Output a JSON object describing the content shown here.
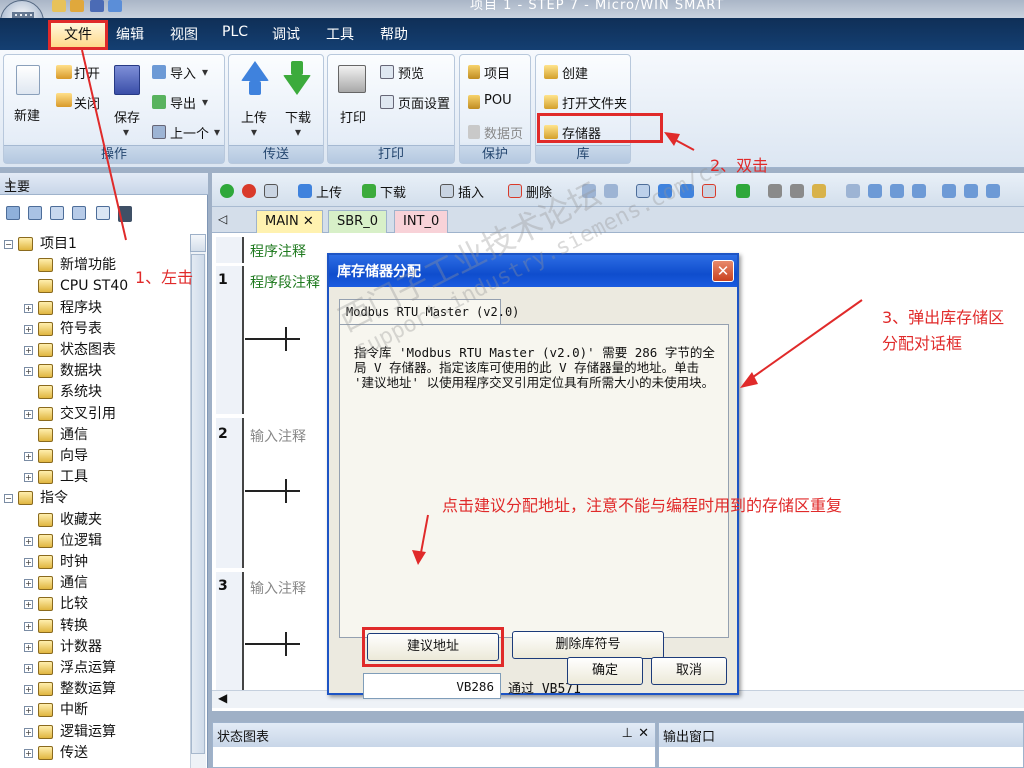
{
  "app": {
    "title": "项目 1 - STEP 7 - Micro/WIN SMART"
  },
  "menu": {
    "items": [
      "文件",
      "编辑",
      "视图",
      "PLC",
      "调试",
      "工具",
      "帮助"
    ]
  },
  "ribbon": {
    "groups": [
      {
        "label": "操作",
        "buttons": [
          "新建",
          "打开",
          "关闭",
          "保存",
          "导入",
          "导出",
          "上一个"
        ]
      },
      {
        "label": "传送",
        "buttons": [
          "上传",
          "下载"
        ]
      },
      {
        "label": "打印",
        "buttons": [
          "打印",
          "预览",
          "页面设置"
        ]
      },
      {
        "label": "保护",
        "buttons": [
          "项目",
          "POU",
          "数据页"
        ]
      },
      {
        "label": "库",
        "buttons": [
          "创建",
          "打开文件夹",
          "存储器"
        ]
      }
    ]
  },
  "left_pane": {
    "title": "主要",
    "tree": [
      "项目1",
      "新增功能",
      "CPU ST40",
      "程序块",
      "符号表",
      "状态图表",
      "数据块",
      "系统块",
      "交叉引用",
      "通信",
      "向导",
      "工具",
      "指令",
      "收藏夹",
      "位逻辑",
      "时钟",
      "通信",
      "比较",
      "转换",
      "计数器",
      "浮点运算",
      "整数运算",
      "中断",
      "逻辑运算",
      "传送"
    ]
  },
  "editor": {
    "toolbar": [
      "上传",
      "下载",
      "插入",
      "删除"
    ],
    "tabs": [
      "MAIN",
      "SBR_0",
      "INT_0"
    ],
    "program_comment": "程序注释",
    "networks": [
      {
        "num": "1",
        "comment": "程序段注释"
      },
      {
        "num": "2",
        "comment": "输入注释"
      },
      {
        "num": "3",
        "comment": "输入注释"
      }
    ]
  },
  "bottom": {
    "left_title": "状态图表",
    "right_title": "输出窗口"
  },
  "dialog": {
    "title": "库存储器分配",
    "tab": "Modbus RTU Master (v2.0)",
    "description": "指令库 'Modbus RTU Master (v2.0)' 需要 286 字节的全局 V 存储器。指定该库可使用的此 V 存储器量的地址。单击 '建议地址' 以使用程序交叉引用定位具有所需大小的未使用块。",
    "suggest_button": "建议地址",
    "delete_button": "删除库符号",
    "start_address": "VB286",
    "through": "通过",
    "end_address": "VB571",
    "ok": "确定",
    "cancel": "取消",
    "close": "✕"
  },
  "annotations": {
    "step1": "1、左击",
    "step2": "2、双击",
    "step3_line1": "3、弹出库存储区",
    "step3_line2": "分配对话框",
    "hint": "点击建议分配地址，注意不能与编程时用到的存储区重复"
  },
  "watermark": {
    "line1": "西门子工业技术论坛",
    "line2": "support.industry.siemens.com/cs"
  },
  "colors": {
    "annotation": "#e02a2a",
    "dialog_title": "#1d54c4",
    "menubar": "#143f72"
  }
}
